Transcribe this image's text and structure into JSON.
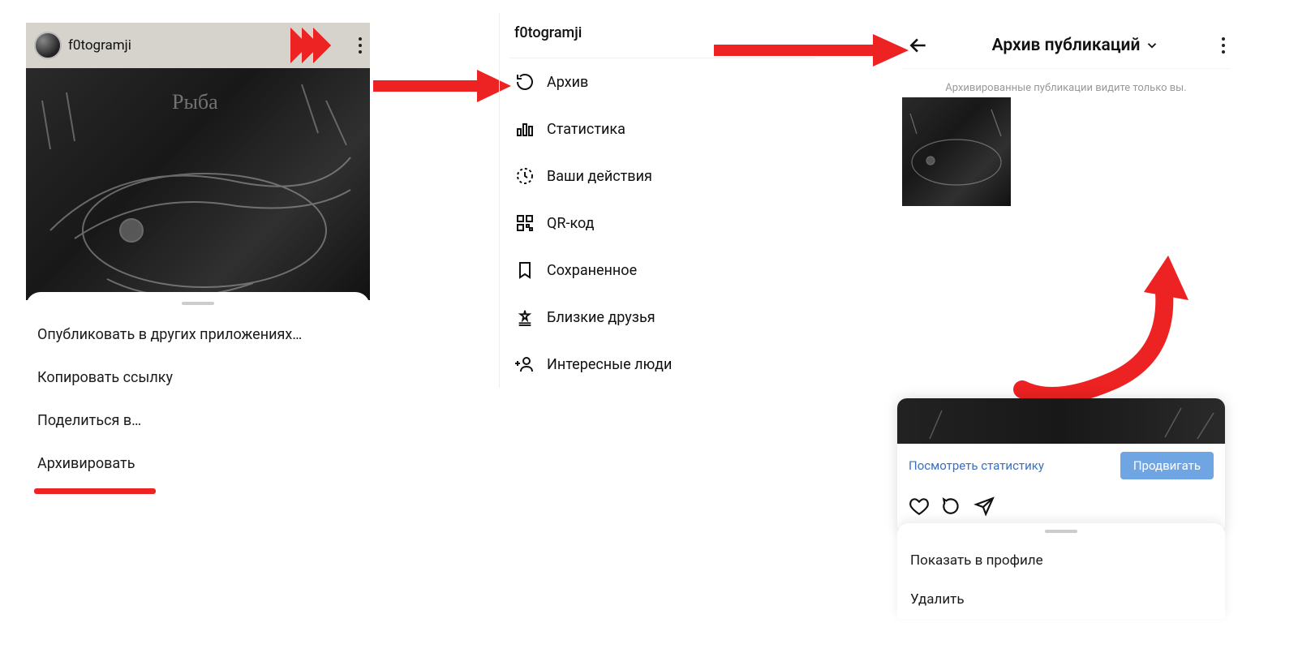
{
  "panel1": {
    "username": "f0togramji",
    "sheet": {
      "items": [
        "Опубликовать в других приложениях…",
        "Копировать ссылку",
        "Поделиться в…",
        "Архивировать"
      ]
    }
  },
  "panel2": {
    "username": "f0togramji",
    "menu": [
      "Архив",
      "Статистика",
      "Ваши действия",
      "QR-код",
      "Сохраненное",
      "Близкие друзья",
      "Интересные люди"
    ]
  },
  "panel3": {
    "title": "Архив публикаций",
    "notice": "Архивированные публикации видите только вы."
  },
  "panel3b": {
    "stats_link": "Посмотреть статистику",
    "promote": "Продвигать",
    "sheet": {
      "items": [
        "Показать в профиле",
        "Удалить"
      ]
    }
  },
  "colors": {
    "accent_red": "#ed2222",
    "link_blue": "#3c6fbf"
  }
}
